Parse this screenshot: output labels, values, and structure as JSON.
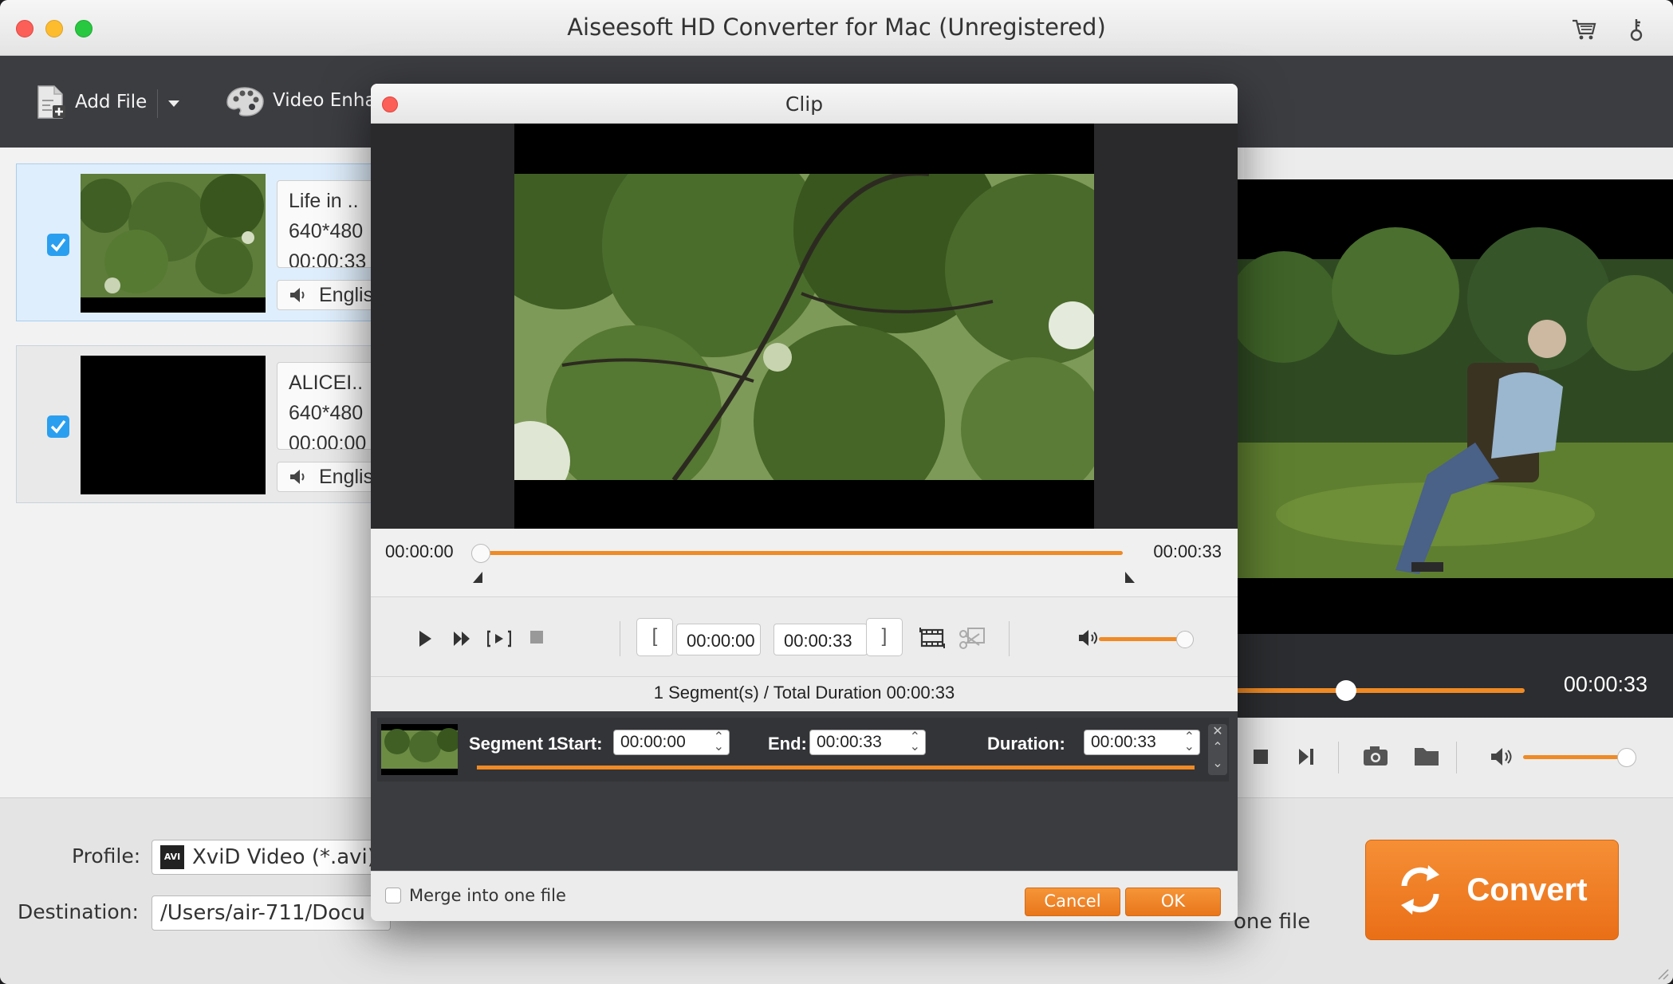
{
  "window": {
    "title": "Aiseesoft HD Converter for Mac (Unregistered)"
  },
  "toolbar": {
    "add_file": "Add File",
    "video_enhance": "Video Enhan"
  },
  "files": [
    {
      "name": "Life in ..",
      "resolution": "640*480",
      "duration": "00:00:33",
      "audio": "English",
      "checked": true,
      "selected": true
    },
    {
      "name": "ALICEI..",
      "resolution": "640*480",
      "duration": "00:00:00",
      "audio": "English",
      "checked": true,
      "selected": false
    }
  ],
  "preview": {
    "time": "00:00:33",
    "progress": 0.38
  },
  "bottom": {
    "profile_label": "Profile:",
    "profile_value": "XviD Video (*.avi)",
    "profile_icon": "AVI",
    "destination_label": "Destination:",
    "destination_value": "/Users/air-711/Docu",
    "merge_text": "one file",
    "convert_label": "Convert"
  },
  "clip_dialog": {
    "title": "Clip",
    "start_time": "00:00:00",
    "end_time": "00:00:33",
    "field_start": "00:00:00",
    "field_end": "00:00:33",
    "bracket_left": "[",
    "bracket_right": "]",
    "summary": "1 Segment(s) / Total Duration 00:00:33",
    "segment": {
      "name": "Segment 1",
      "start_label": "Start:",
      "start_value": "00:00:00",
      "end_label": "End:",
      "end_value": "00:00:33",
      "duration_label": "Duration:",
      "duration_value": "00:00:33"
    },
    "merge_label": "Merge into one file",
    "cancel": "Cancel",
    "ok": "OK"
  },
  "colors": {
    "accent": "#f08a24",
    "toolbar": "#3c3d41",
    "checkbox": "#2a9ff0"
  }
}
